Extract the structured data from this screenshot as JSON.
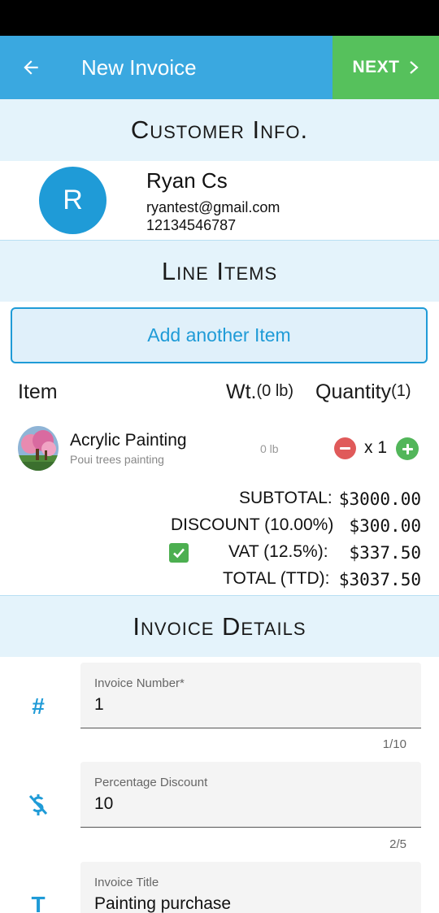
{
  "app_bar": {
    "title": "New Invoice",
    "next_label": "NEXT"
  },
  "sections": {
    "customer": "Customer Info.",
    "line_items": "Line Items",
    "invoice_details": "Invoice Details"
  },
  "customer": {
    "initial": "R",
    "name": "Ryan Cs",
    "email": "ryantest@gmail.com",
    "phone": "12134546787"
  },
  "line_items": {
    "add_button": "Add another Item",
    "headers": {
      "item": "Item",
      "wt": "Wt.",
      "wt_total": "(0 lb)",
      "quantity": "Quantity",
      "quantity_total": "(1)"
    },
    "items": [
      {
        "name": "Acrylic Painting",
        "description": "Poui trees painting",
        "weight": "0 lb",
        "quantity": "x 1"
      }
    ]
  },
  "totals": {
    "subtotal_label": "SUBTOTAL:",
    "subtotal_value": "$3000.00",
    "discount_label": "DISCOUNT (10.00%)",
    "discount_value": "$300.00",
    "vat_label": "VAT (12.5%):",
    "vat_value": "$337.50",
    "vat_checked": true,
    "total_label": "TOTAL (TTD):",
    "total_value": "$3037.50"
  },
  "invoice_details": {
    "fields": [
      {
        "icon": "hash-icon",
        "icon_glyph": "#",
        "label": "Invoice Number*",
        "value": "1",
        "counter": "1/10"
      },
      {
        "icon": "money-off-icon",
        "icon_glyph": "$",
        "label": "Percentage Discount",
        "value": "10",
        "counter": "2/5"
      },
      {
        "icon": "title-icon",
        "icon_glyph": "T",
        "label": "Invoice Title",
        "value": "Painting purchase"
      }
    ]
  },
  "colors": {
    "app_bar": "#3aa8e0",
    "next_button": "#56c15c",
    "section_bg": "#e4f3fb",
    "accent": "#1f9bd7",
    "minus": "#e05a5a",
    "plus": "#52b65a"
  }
}
